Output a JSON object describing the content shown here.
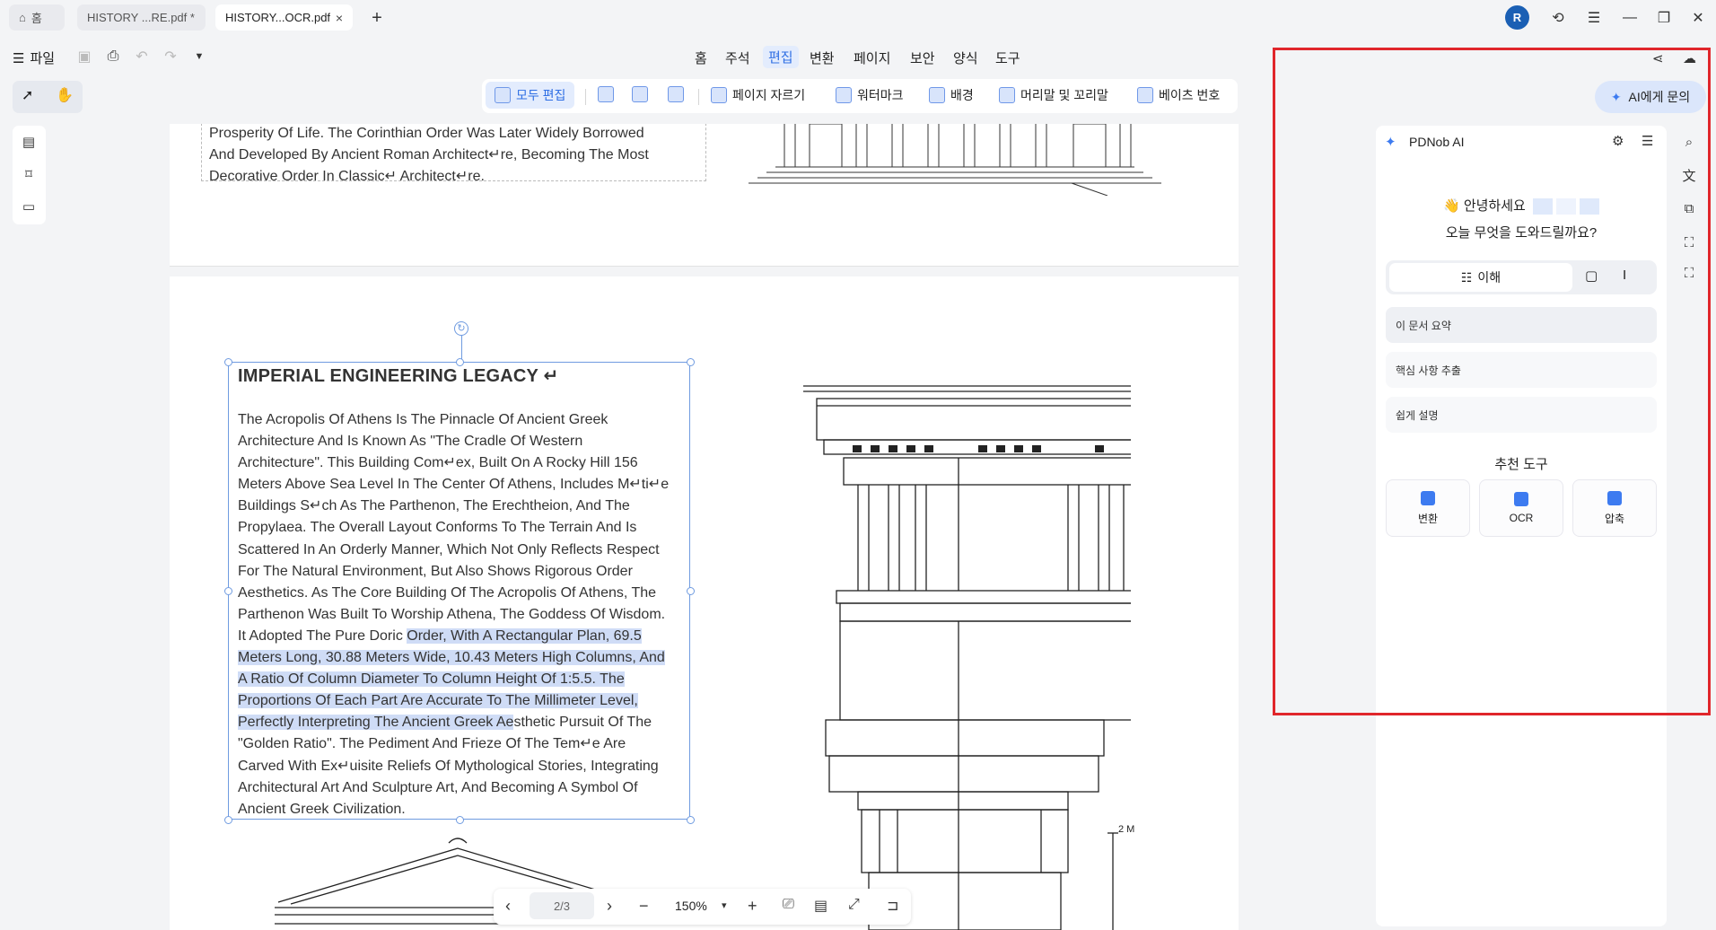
{
  "tabs": {
    "home": "홈",
    "doc1": "HISTORY ...RE.pdf *",
    "doc2": "HISTORY...OCR.pdf",
    "close": "×",
    "new": "+"
  },
  "avatar_initial": "R",
  "file_menu": "파일",
  "menu": [
    "홈",
    "주석",
    "편집",
    "변환",
    "페이지",
    "보안",
    "양식",
    "도구"
  ],
  "active_menu": "편집",
  "toolbar": {
    "edit_all": "모두 편집",
    "crop": "페이지 자르기",
    "watermark": "워터마크",
    "background": "배경",
    "header_footer": "머리말 및 꼬리말",
    "bates": "베이츠 번호"
  },
  "page1": {
    "lines": [
      "Prosperity Of Life. The Corinthian Order Was Later Widely Borrowed",
      "And Developed By Ancient Roman Architect↵re, Becoming The Most",
      "Decorative Order In Classic↵ Architect↵re."
    ]
  },
  "page2": {
    "heading": "IMPERIAL ENGINEERING LEGACY ↵",
    "lines": [
      "The Acropolis Of Athens Is The Pinnacle Of Ancient Greek",
      "Architecture And Is Known As \"The Cradle Of Western",
      "Architecture\". This Building Com↵ex, Built On A Rocky Hill 156",
      "Meters Above Sea Level In The Center Of Athens, Includes M↵ti↵e",
      "Buildings S↵ch As The Parthenon, The Erechtheion, And The",
      "Propylaea. The Overall Layout Conforms To The Terrain And Is",
      "Scattered In An Orderly Manner, Which Not Only Reflects Respect",
      "For The Natural Environment, But Also Shows Rigorous Order",
      "Aesthetics. As The Core Building Of The Acropolis Of Athens, The",
      "Parthenon Was Built To Worship Athena, The Goddess Of Wisdom."
    ],
    "line_mixed_a": "It Adopted The Pure Doric ",
    "line_mixed_b": "Order, With A Rectangular Plan, 69.5",
    "hl_lines": [
      "Meters Long, 30.88 Meters Wide, 10.43 Meters High Columns, And",
      "A Ratio Of Column Diameter To Column Height Of 1:5.5. The",
      "Proportions Of Each Part Are Accurate To The Millimeter Level,"
    ],
    "line_mixed_c": "Perfectly Interpreting The Ancient Greek Ae",
    "line_mixed_d": "sthetic Pursuit Of The",
    "tail_lines": [
      "\"Golden Ratio\". The Pediment And Frieze Of The Tem↵e Are",
      "Carved With Ex↵uisite Reliefs Of Mythological Stories, Integrating",
      "Architectural Art And Sculpture Art, And Becoming A Symbol Of",
      "Ancient Greek Civilization."
    ],
    "scale_label": "2 M"
  },
  "bottom_bar": {
    "page": "2/3",
    "zoom": "150%",
    "zoom_arrow": "▾"
  },
  "ai": {
    "ask_button": "AI에게 문의",
    "title": "PDNob AI",
    "greeting": "안녕하세요",
    "question": "오늘 무엇을 도와드릴까요?",
    "tab_understand": "이해",
    "suggestions": [
      "이 문서 요약",
      "핵심 사항 추출",
      "쉽게 설명"
    ],
    "recommended_title": "추천 도구",
    "tools": [
      "변환",
      "OCR",
      "압축"
    ]
  },
  "colors": {
    "accent": "#2f6fe4",
    "highlight": "#cfdcf6",
    "frame": "#e0262b"
  }
}
